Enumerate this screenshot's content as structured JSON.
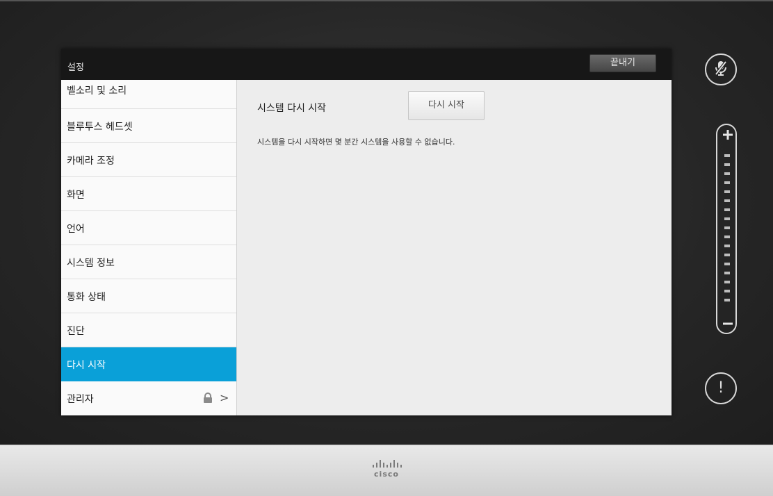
{
  "header": {
    "title": "설정",
    "exit_label": "끝내기"
  },
  "sidebar": {
    "items": [
      {
        "label": "벨소리 및 소리"
      },
      {
        "label": "블루투스 헤드셋"
      },
      {
        "label": "카메라 조정"
      },
      {
        "label": "화면"
      },
      {
        "label": "언어"
      },
      {
        "label": "시스템 정보"
      },
      {
        "label": "통화 상태"
      },
      {
        "label": "진단"
      },
      {
        "label": "다시 시작",
        "active": true
      },
      {
        "label": "관리자",
        "locked": true
      }
    ]
  },
  "content": {
    "setting_label": "시스템 다시 시작",
    "button_label": "다시 시작",
    "description": "시스템을 다시 시작하면 몇 분간 시스템을 사용할 수 없습니다."
  },
  "side_controls": {
    "mute_icon": "microphone-muted-icon",
    "volume_up_icon": "plus-icon",
    "volume_down_icon": "minus-icon",
    "alert_icon": "exclamation-icon",
    "alert_glyph": "!"
  },
  "footer": {
    "brand": "cisco"
  },
  "colors": {
    "accent": "#0aa0d8",
    "header": "#171717",
    "panel": "#ededed"
  }
}
